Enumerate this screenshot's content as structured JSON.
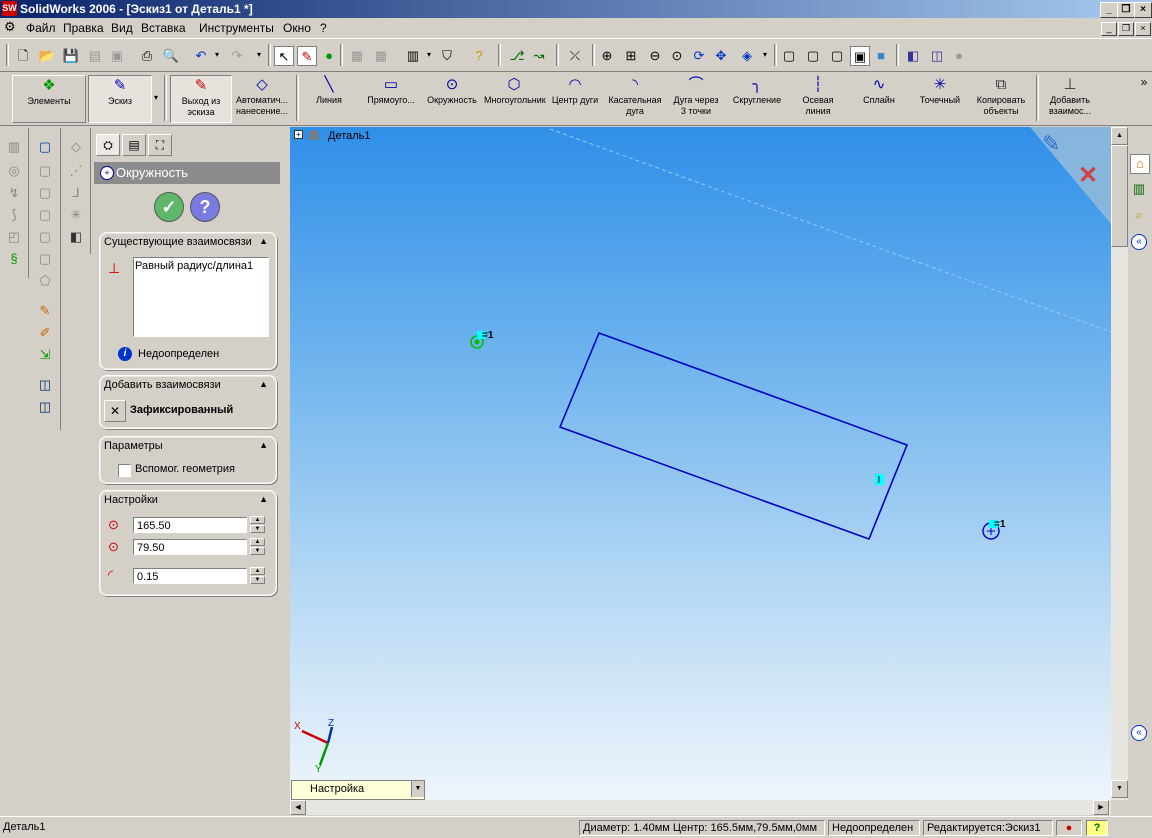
{
  "window": {
    "title": "SolidWorks 2006 - [Эскиз1 от Деталь1 *]",
    "logo": "SW"
  },
  "menu": {
    "items": [
      "Файл",
      "Правка",
      "Вид",
      "Вставка",
      "Инструменты",
      "Окно",
      "?"
    ]
  },
  "command_manager": {
    "groups": {
      "features": "Элементы",
      "sketch": "Эскиз"
    },
    "tools": [
      {
        "label_1": "Выход из",
        "label_2": "эскиза",
        "icon": "exit-sketch-icon"
      },
      {
        "label_1": "Автоматич...",
        "label_2": "нанесение...",
        "icon": "smart-dimension-icon"
      },
      {
        "label_1": "Линия",
        "label_2": "",
        "icon": "line-icon"
      },
      {
        "label_1": "Прямоуго...",
        "label_2": "",
        "icon": "rectangle-icon"
      },
      {
        "label_1": "Окружность",
        "label_2": "",
        "icon": "circle-icon"
      },
      {
        "label_1": "Многоугольник",
        "label_2": "",
        "icon": "polygon-icon"
      },
      {
        "label_1": "Центр дуги",
        "label_2": "",
        "icon": "centerpoint-arc-icon"
      },
      {
        "label_1": "Касательная",
        "label_2": "дуга",
        "icon": "tangent-arc-icon"
      },
      {
        "label_1": "Дуга через",
        "label_2": "3 точки",
        "icon": "three-point-arc-icon"
      },
      {
        "label_1": "Скругление",
        "label_2": "",
        "icon": "fillet-icon"
      },
      {
        "label_1": "Осевая",
        "label_2": "линия",
        "icon": "centerline-icon"
      },
      {
        "label_1": "Сплайн",
        "label_2": "",
        "icon": "spline-icon"
      },
      {
        "label_1": "Точечный",
        "label_2": "",
        "icon": "point-icon"
      },
      {
        "label_1": "Копировать",
        "label_2": "объекты",
        "icon": "copy-entities-icon"
      },
      {
        "label_1": "Добавить",
        "label_2": "взаимос...",
        "icon": "add-relation-icon"
      }
    ],
    "overflow": "»"
  },
  "property_manager": {
    "title": "Окружность",
    "existing_relations": {
      "header": "Существующие взаимосвязи",
      "items": [
        "Равный радиус/длина1"
      ],
      "status": "Недоопределен"
    },
    "add_relations": {
      "header": "Добавить взаимосвязи",
      "fixed": "Зафиксированный"
    },
    "options": {
      "header": "Параметры",
      "construction": "Вспомог. геометрия",
      "construction_checked": false
    },
    "parameters": {
      "header": "Настройки",
      "center_x": "165.50",
      "center_y": "79.50",
      "radius": "0.15"
    }
  },
  "viewport": {
    "tree_root": "Деталь1",
    "triad": {
      "x": "X",
      "y": "Y",
      "z": "Z"
    },
    "relation_tags": [
      "=1",
      "=1"
    ],
    "view_dropdown": "Настройка"
  },
  "status_bar": {
    "document": "Деталь1",
    "measure": "Диаметр: 1.40мм  Центр: 165.5мм,79.5мм,0мм",
    "state": "Недоопределен",
    "editing": "Редактируется:Эскиз1",
    "help": "?"
  },
  "colors": {
    "sketch_line": "#0000c0",
    "selection_green": "#00c000",
    "relation_cyan": "#00ffff",
    "title_start": "#0a246a",
    "title_end": "#a6caf0"
  }
}
